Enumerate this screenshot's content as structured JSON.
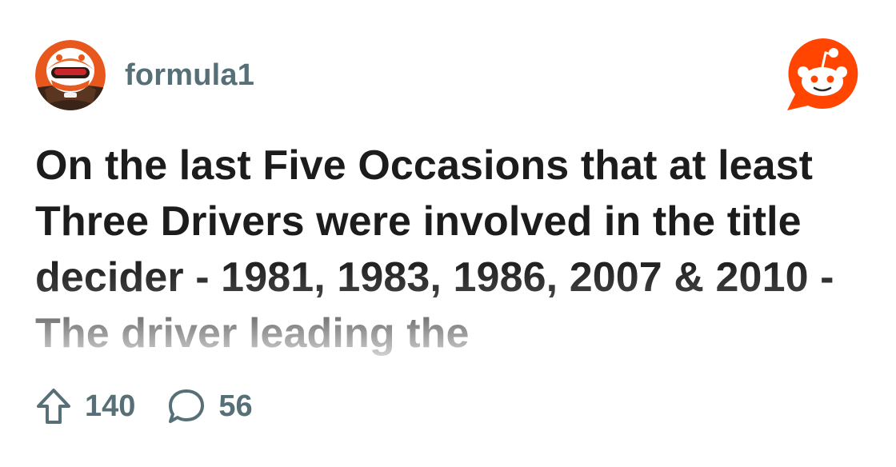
{
  "subreddit": {
    "name": "formula1",
    "avatar_icon": "helmet-avatar-icon"
  },
  "brand": {
    "icon": "reddit-snoo-icon",
    "color": "#ff4500"
  },
  "post": {
    "title": "On the last Five Occasions that at least Three Drivers were involved in the title decider - 1981, 1983, 1986, 2007 & 2010 - The driver leading the"
  },
  "actions": {
    "upvotes": "140",
    "comments": "56",
    "upvote_icon": "upvote-arrow-icon",
    "comment_icon": "comment-bubble-icon"
  },
  "colors": {
    "title": "#1c1c1c",
    "meta": "#576f76",
    "background": "#ffffff"
  }
}
